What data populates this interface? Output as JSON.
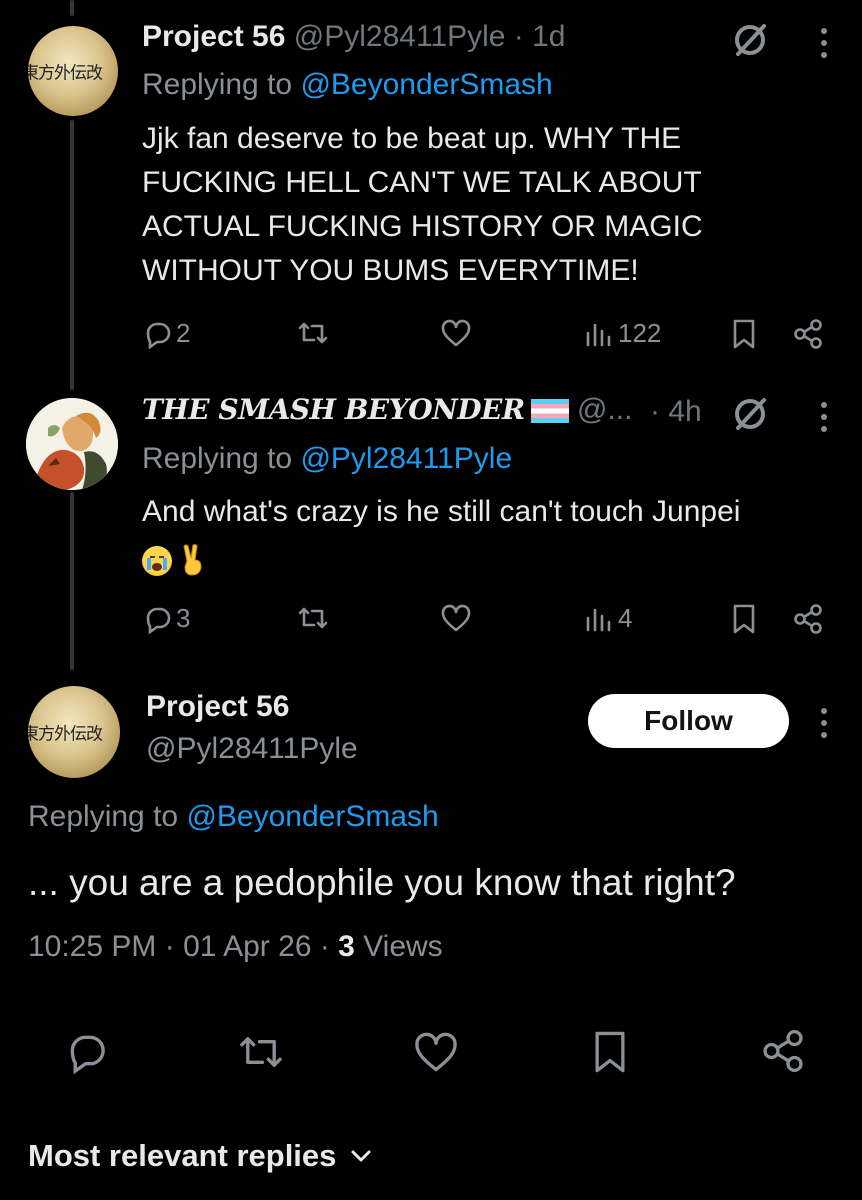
{
  "tweet1": {
    "display_name": "Project 56",
    "handle": "@Pyl28411Pyle",
    "time": "· 1d",
    "replying_prefix": "Replying to ",
    "replying_to": "@BeyonderSmash",
    "body": "Jjk fan deserve to be beat up. WHY THE FUCKING HELL CAN'T WE TALK ABOUT ACTUAL FUCKING HISTORY OR MAGIC WITHOUT YOU BUMS EVERYTIME!",
    "replies": "2",
    "views": "122",
    "avatar_text": "東方外伝改"
  },
  "tweet2": {
    "display_name": "THE SMASH BEYONDER",
    "handle": "@...",
    "time": "· 4h",
    "replying_prefix": "Replying to ",
    "replying_to": "@Pyl28411Pyle",
    "body": "And what's crazy is he still can't touch Junpei",
    "replies": "3",
    "views": "4"
  },
  "main": {
    "display_name": "Project 56",
    "handle": "@Pyl28411Pyle",
    "follow_label": "Follow",
    "replying_prefix": "Replying to ",
    "replying_to": "@BeyonderSmash",
    "body": "... you are a pedophile you know that right?",
    "timestamp": "10:25 PM · 01 Apr 26 · ",
    "views_count": "3",
    "views_label": " Views",
    "avatar_text": "東方外伝改"
  },
  "footer": {
    "sort_label": "Most relevant replies"
  },
  "colors": {
    "background": "#000000",
    "text": "#e7e9ea",
    "muted": "#8b9096",
    "link": "#1d9bf0"
  }
}
